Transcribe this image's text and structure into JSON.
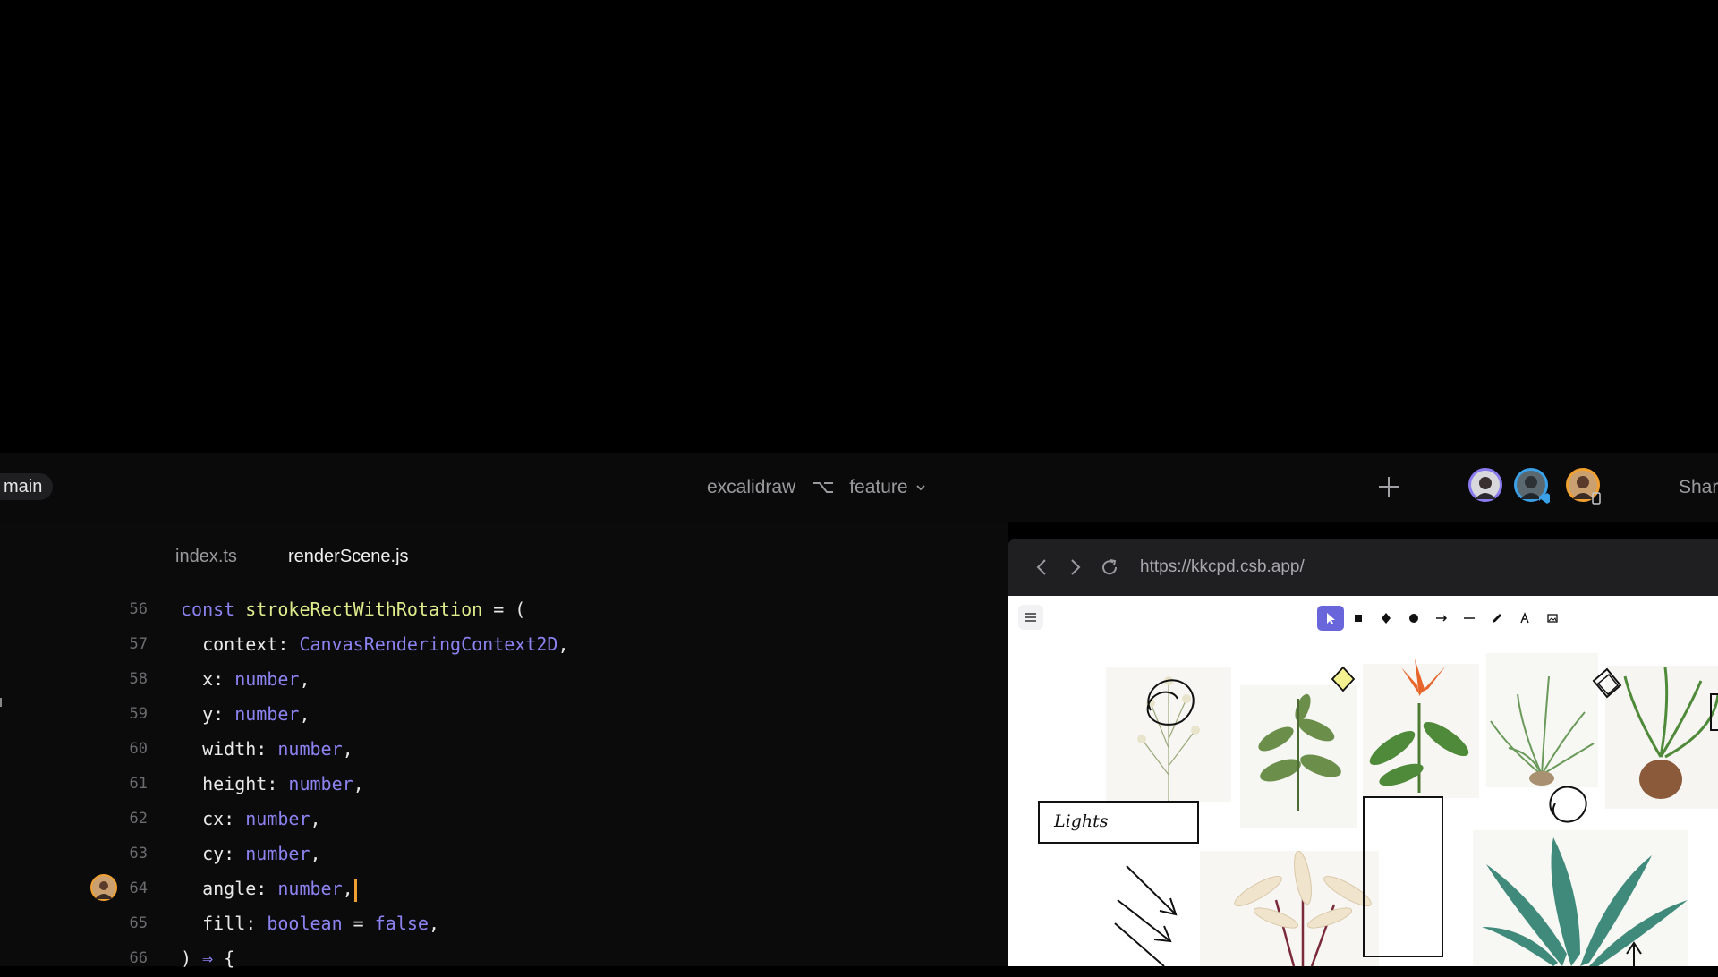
{
  "header": {
    "branch_pill": "main",
    "repo_name": "excalidraw",
    "branch_name": "feature",
    "share_label": "Shar"
  },
  "avatars": [
    {
      "name": "collaborator-1",
      "accent": "#8a7cf0"
    },
    {
      "name": "collaborator-2",
      "accent": "#3aa0e8"
    },
    {
      "name": "collaborator-3",
      "accent": "#f0a030"
    }
  ],
  "editor": {
    "tabs": [
      {
        "label": "index.ts",
        "active": false
      },
      {
        "label": "renderScene.js",
        "active": true
      }
    ],
    "lines": [
      {
        "number": "56",
        "code": [
          [
            "kw",
            "const "
          ],
          [
            "fn",
            "strokeRectWithRotation"
          ],
          [
            "pn",
            " = ("
          ]
        ]
      },
      {
        "number": "57",
        "code": [
          [
            "pn",
            "  context: "
          ],
          [
            "ty",
            "CanvasRenderingContext2D"
          ],
          [
            "pn",
            ","
          ]
        ]
      },
      {
        "number": "58",
        "code": [
          [
            "pn",
            "  x: "
          ],
          [
            "ty",
            "number"
          ],
          [
            "pn",
            ","
          ]
        ]
      },
      {
        "number": "59",
        "code": [
          [
            "pn",
            "  y: "
          ],
          [
            "ty",
            "number"
          ],
          [
            "pn",
            ","
          ]
        ]
      },
      {
        "number": "60",
        "code": [
          [
            "pn",
            "  width: "
          ],
          [
            "ty",
            "number"
          ],
          [
            "pn",
            ","
          ]
        ]
      },
      {
        "number": "61",
        "code": [
          [
            "pn",
            "  height: "
          ],
          [
            "ty",
            "number"
          ],
          [
            "pn",
            ","
          ]
        ]
      },
      {
        "number": "62",
        "code": [
          [
            "pn",
            "  cx: "
          ],
          [
            "ty",
            "number"
          ],
          [
            "pn",
            ","
          ]
        ]
      },
      {
        "number": "63",
        "code": [
          [
            "pn",
            "  cy: "
          ],
          [
            "ty",
            "number"
          ],
          [
            "pn",
            ","
          ]
        ]
      },
      {
        "number": "64",
        "code": [
          [
            "pn",
            "  angle: "
          ],
          [
            "ty",
            "number"
          ],
          [
            "pn",
            ","
          ]
        ],
        "cursor": true,
        "collaborator": true
      },
      {
        "number": "65",
        "code": [
          [
            "pn",
            "  fill: "
          ],
          [
            "ty",
            "boolean"
          ],
          [
            "pn",
            " = "
          ],
          [
            "kw",
            "false"
          ],
          [
            "pn",
            ","
          ]
        ]
      },
      {
        "number": "66",
        "code": [
          [
            "pn",
            ") "
          ],
          [
            "kw",
            "⇒"
          ],
          [
            "pn",
            " {"
          ]
        ]
      }
    ],
    "colors": {
      "keyword": "#8c83f0",
      "function": "#e0eb8c",
      "cursor": "#f0a030"
    }
  },
  "browser": {
    "url": "https://kkcpd.csb.app/",
    "canvas_label": "Lights",
    "tools": [
      "selection-tool",
      "rectangle-tool",
      "diamond-tool",
      "ellipse-tool",
      "arrow-tool",
      "line-tool",
      "pencil-tool",
      "text-tool",
      "image-tool"
    ],
    "accent": "#6965db"
  }
}
